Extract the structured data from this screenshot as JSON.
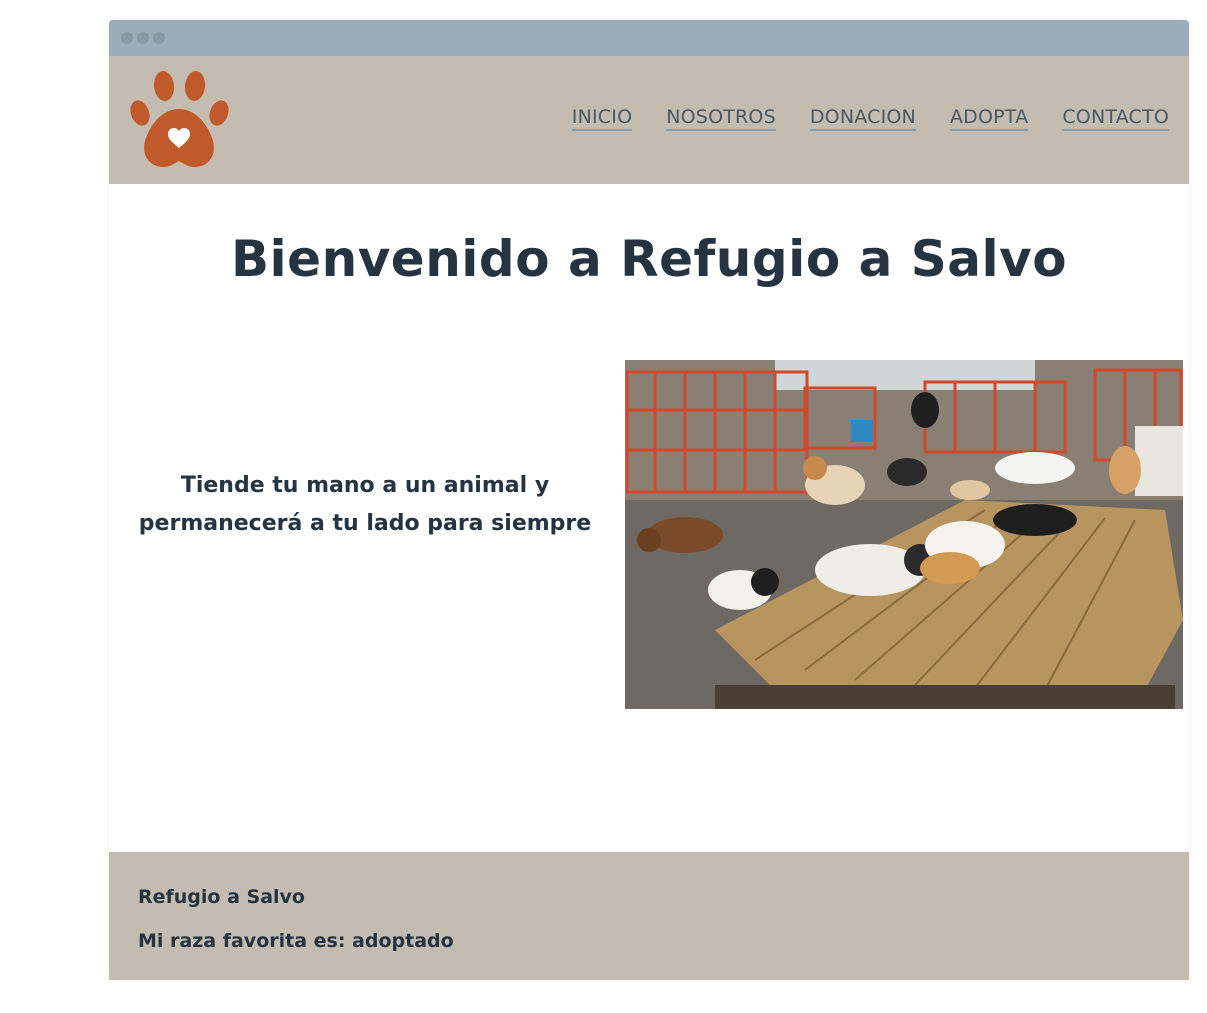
{
  "nav": {
    "items": [
      {
        "label": "INICIO"
      },
      {
        "label": "NOSOTROS"
      },
      {
        "label": "DONACION"
      },
      {
        "label": "ADOPTA"
      },
      {
        "label": "CONTACTO"
      }
    ]
  },
  "main": {
    "title": "Bienvenido a Refugio a Salvo",
    "tagline_line1": "Tiende tu mano a un animal y",
    "tagline_line2": "permanecerá a tu lado para siempre"
  },
  "footer": {
    "name": "Refugio a Salvo",
    "slogan": "Mi raza favorita es: adoptado"
  },
  "icons": {
    "logo": "paw-heart-icon"
  },
  "colors": {
    "titlebar": "#9aadb9",
    "header_bg": "#c4bcb0",
    "text_dark": "#263441",
    "logo": "#c05a2b"
  }
}
